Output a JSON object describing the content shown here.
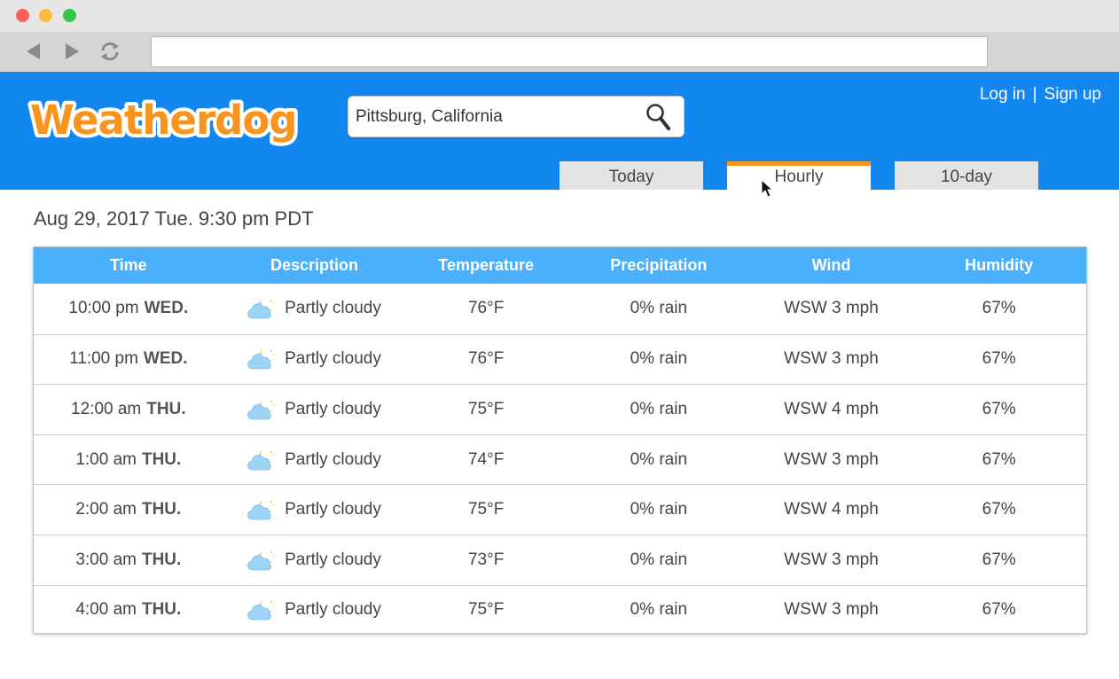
{
  "browser": {
    "address": ""
  },
  "app": {
    "name": "Weatherdog",
    "search_value": "Pittsburg, California",
    "login": "Log in",
    "separator": "|",
    "signup": "Sign up",
    "tabs": [
      "Today",
      "Hourly",
      "10-day"
    ],
    "active_tab": "Hourly"
  },
  "date_line": "Aug 29, 2017 Tue. 9:30 pm PDT",
  "table": {
    "headers": [
      "Time",
      "Description",
      "Temperature",
      "Precipitation",
      "Wind",
      "Humidity"
    ],
    "rows": [
      {
        "time": "10:00 pm",
        "day": "WED.",
        "desc": "Partly cloudy",
        "temp": "76°F",
        "prec": "0% rain",
        "wind": "WSW 3 mph",
        "hum": "67%"
      },
      {
        "time": "11:00 pm",
        "day": "WED.",
        "desc": "Partly cloudy",
        "temp": "76°F",
        "prec": "0% rain",
        "wind": "WSW 3 mph",
        "hum": "67%"
      },
      {
        "time": "12:00 am",
        "day": "THU.",
        "desc": "Partly cloudy",
        "temp": "75°F",
        "prec": "0% rain",
        "wind": "WSW 4 mph",
        "hum": "67%"
      },
      {
        "time": "1:00 am",
        "day": "THU.",
        "desc": "Partly cloudy",
        "temp": "74°F",
        "prec": "0% rain",
        "wind": "WSW 3 mph",
        "hum": "67%"
      },
      {
        "time": "2:00 am",
        "day": "THU.",
        "desc": "Partly cloudy",
        "temp": "75°F",
        "prec": "0% rain",
        "wind": "WSW 4 mph",
        "hum": "67%"
      },
      {
        "time": "3:00 am",
        "day": "THU.",
        "desc": "Partly cloudy",
        "temp": "73°F",
        "prec": "0% rain",
        "wind": "WSW 3 mph",
        "hum": "67%"
      },
      {
        "time": "4:00 am",
        "day": "THU.",
        "desc": "Partly cloudy",
        "temp": "75°F",
        "prec": "0% rain",
        "wind": "WSW 3 mph",
        "hum": "67%"
      }
    ]
  },
  "colors": {
    "header_blue": "#1287f0",
    "table_header_blue": "#4ab0fb",
    "active_tab_accent": "#f7941d",
    "logo_orange": "#f7941d"
  },
  "icons": {
    "back": "back-arrow-icon",
    "forward": "forward-arrow-icon",
    "reload": "reload-icon",
    "search": "magnifier-icon",
    "weather": "partly-cloudy-night-icon",
    "cursor": "mouse-pointer-icon"
  }
}
